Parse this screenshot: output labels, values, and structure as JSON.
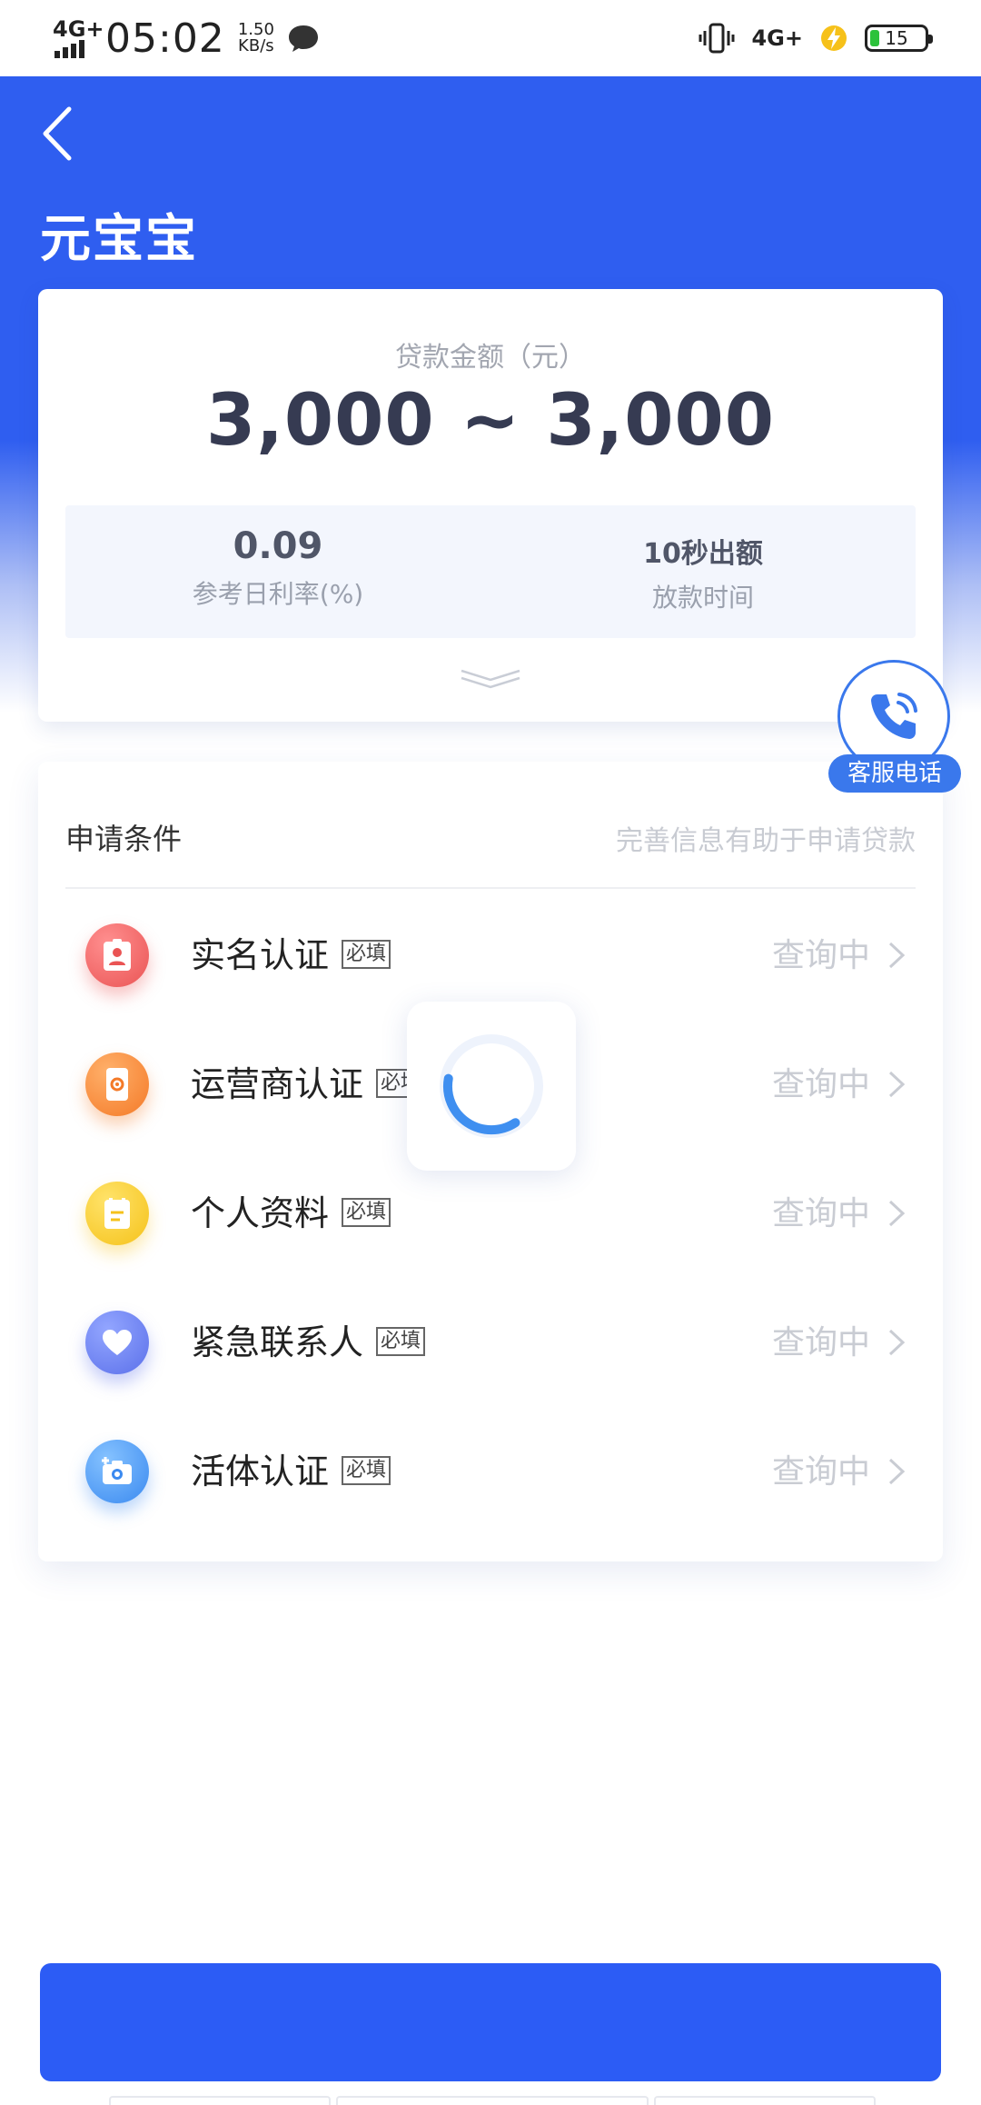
{
  "status_bar": {
    "network_left": "4G+",
    "time": "05:02",
    "speed_value": "1.50",
    "speed_unit": "KB/s",
    "network_right": "4G+",
    "battery": "15",
    "icons": [
      "signal-icon",
      "chat-bubble-icon",
      "vibrate-icon",
      "charging-bolt-icon",
      "battery-icon"
    ]
  },
  "header": {
    "title": "元宝宝",
    "back_icon": "chevron-left-icon",
    "bg_color": "#2f5ef0"
  },
  "loan": {
    "amount_label": "贷款金额（元）",
    "amount_value": "3,000 ~ 3,000",
    "rate_value": "0.09",
    "rate_label": "参考日利率(%)",
    "time_value": "10秒出额",
    "time_label": "放款时间"
  },
  "customer_service": {
    "label": "客服电话",
    "icon": "phone-icon",
    "color": "#3a78ec"
  },
  "conditions": {
    "title": "申请条件",
    "hint": "完善信息有助于申请贷款",
    "required_badge": "必填",
    "items": [
      {
        "name": "实名认证",
        "status": "查询中",
        "icon": "id-badge-icon",
        "color": "#f06a6a"
      },
      {
        "name": "运营商认证",
        "status": "查询中",
        "icon": "phone-settings-icon",
        "color": "#f8883a"
      },
      {
        "name": "个人资料",
        "status": "查询中",
        "icon": "document-icon",
        "color": "#fbcf2f"
      },
      {
        "name": "紧急联系人",
        "status": "查询中",
        "icon": "heart-icon",
        "color": "#6f86f4"
      },
      {
        "name": "活体认证",
        "status": "查询中",
        "icon": "camera-icon",
        "color": "#4f9bf3"
      }
    ]
  },
  "submit": {
    "label": "",
    "color": "#2c5cf5"
  }
}
